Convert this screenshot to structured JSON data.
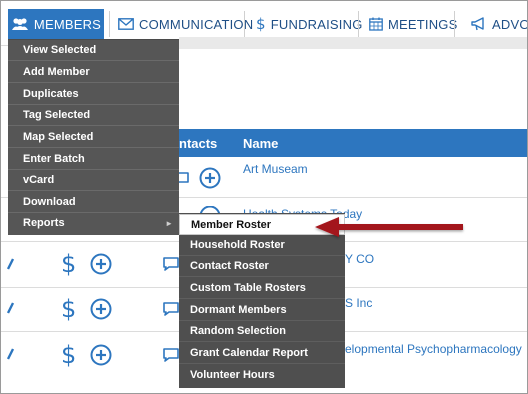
{
  "nav": {
    "items": [
      {
        "label": "MEMBERS",
        "icon": "users-icon"
      },
      {
        "label": "COMMUNICATION",
        "icon": "envelope-icon"
      },
      {
        "label": "FUNDRAISING",
        "icon": "dollar-icon"
      },
      {
        "label": "MEETINGS",
        "icon": "calendar-icon"
      },
      {
        "label": "ADVO",
        "icon": "megaphone-icon"
      }
    ]
  },
  "table": {
    "headers": [
      "ntacts",
      "Name"
    ],
    "names": [
      "Art Museam",
      "Health Systems Today",
      "Y CO",
      "S Inc",
      "elopmental Psychopharmacology"
    ]
  },
  "menu": {
    "items": [
      "View Selected",
      "Add Member",
      "Duplicates",
      "Tag Selected",
      "Map Selected",
      "Enter Batch",
      "vCard",
      "Download",
      "Reports"
    ],
    "submenu_indicator": "►"
  },
  "submenu": {
    "items": [
      "Member Roster",
      "Household Roster",
      "Contact Roster",
      "Custom Table Rosters",
      "Dormant Members",
      "Random Selection",
      "Grant Calendar Report",
      "Volunteer Hours"
    ],
    "highlighted": "Member Roster"
  },
  "colors": {
    "brand_blue": "#2d76bf",
    "menu_grey": "#565656",
    "arrow_red": "#a3121b"
  },
  "icons": {
    "dollar": "$"
  }
}
